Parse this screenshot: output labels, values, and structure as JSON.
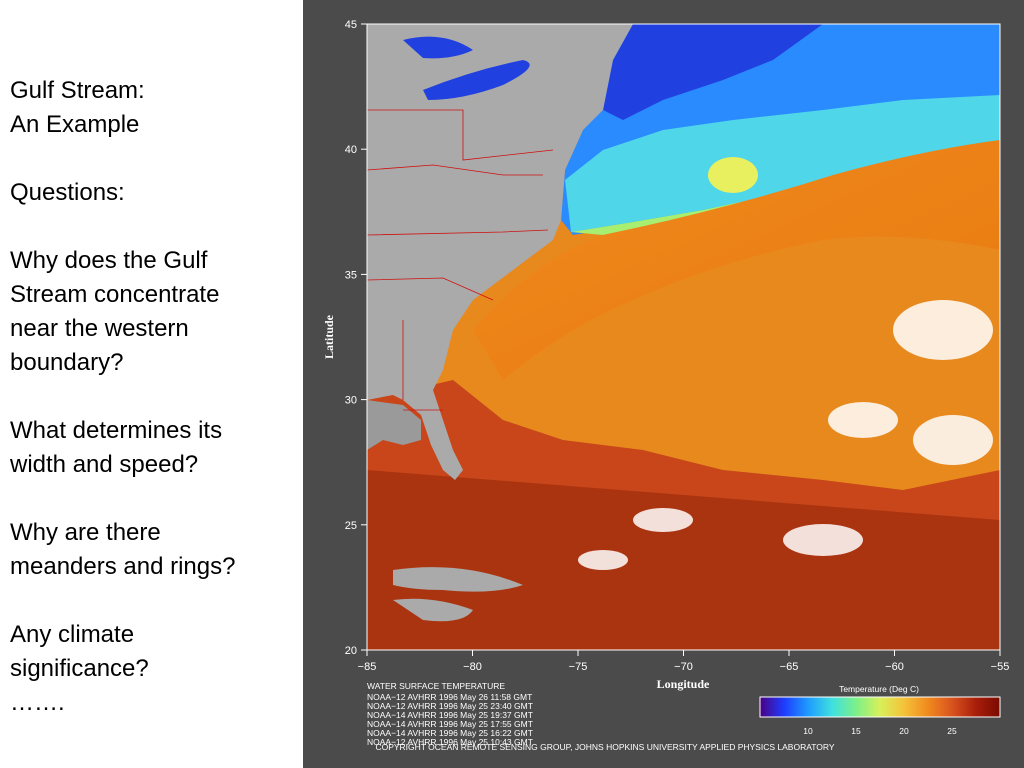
{
  "slide": {
    "lines": [
      "Gulf Stream:",
      "An Example",
      "",
      "Questions:",
      "",
      "Why does the Gulf",
      "Stream concentrate",
      "near the western",
      "boundary?",
      "",
      "What determines its",
      "width and speed?",
      "",
      "Why are there",
      "meanders and rings?",
      "",
      "Any climate",
      "significance?",
      "……."
    ]
  },
  "figure": {
    "x_axis": {
      "label": "Longitude",
      "ticks": [
        "−85",
        "−80",
        "−75",
        "−70",
        "−65",
        "−60",
        "−55"
      ],
      "range": [
        -85,
        -55
      ]
    },
    "y_axis": {
      "label": "Latitude",
      "ticks": [
        "45",
        "40",
        "35",
        "30",
        "25",
        "20"
      ],
      "range": [
        20,
        45
      ]
    },
    "info_title": "WATER SURFACE TEMPERATURE",
    "info_lines": [
      "NOAA−12 AVHRR 1996 May 26 11:58 GMT",
      "NOAA−12 AVHRR 1996 May 25 23:40 GMT",
      "NOAA−14 AVHRR 1996 May 25 19:37 GMT",
      "NOAA−14 AVHRR 1996 May 25 17:55 GMT",
      "NOAA−14 AVHRR 1996 May 25 16:22 GMT",
      "NOAA−12 AVHRR 1996 May 25 10:43 GMT"
    ],
    "copyright": "COPYRIGHT OCEAN REMOTE SENSING GROUP, JOHNS HOPKINS UNIVERSITY APPLIED PHYSICS LABORATORY",
    "colorbar": {
      "title": "Temperature (Deg C)",
      "ticks": [
        "10",
        "15",
        "20",
        "25"
      ],
      "colors": [
        "#4b0082",
        "#1e3cff",
        "#1e9bff",
        "#3fe0e0",
        "#7cf08a",
        "#d8f05a",
        "#f5c23a",
        "#f08a1e",
        "#d9531e",
        "#a81e0a",
        "#7a0a00"
      ]
    }
  }
}
